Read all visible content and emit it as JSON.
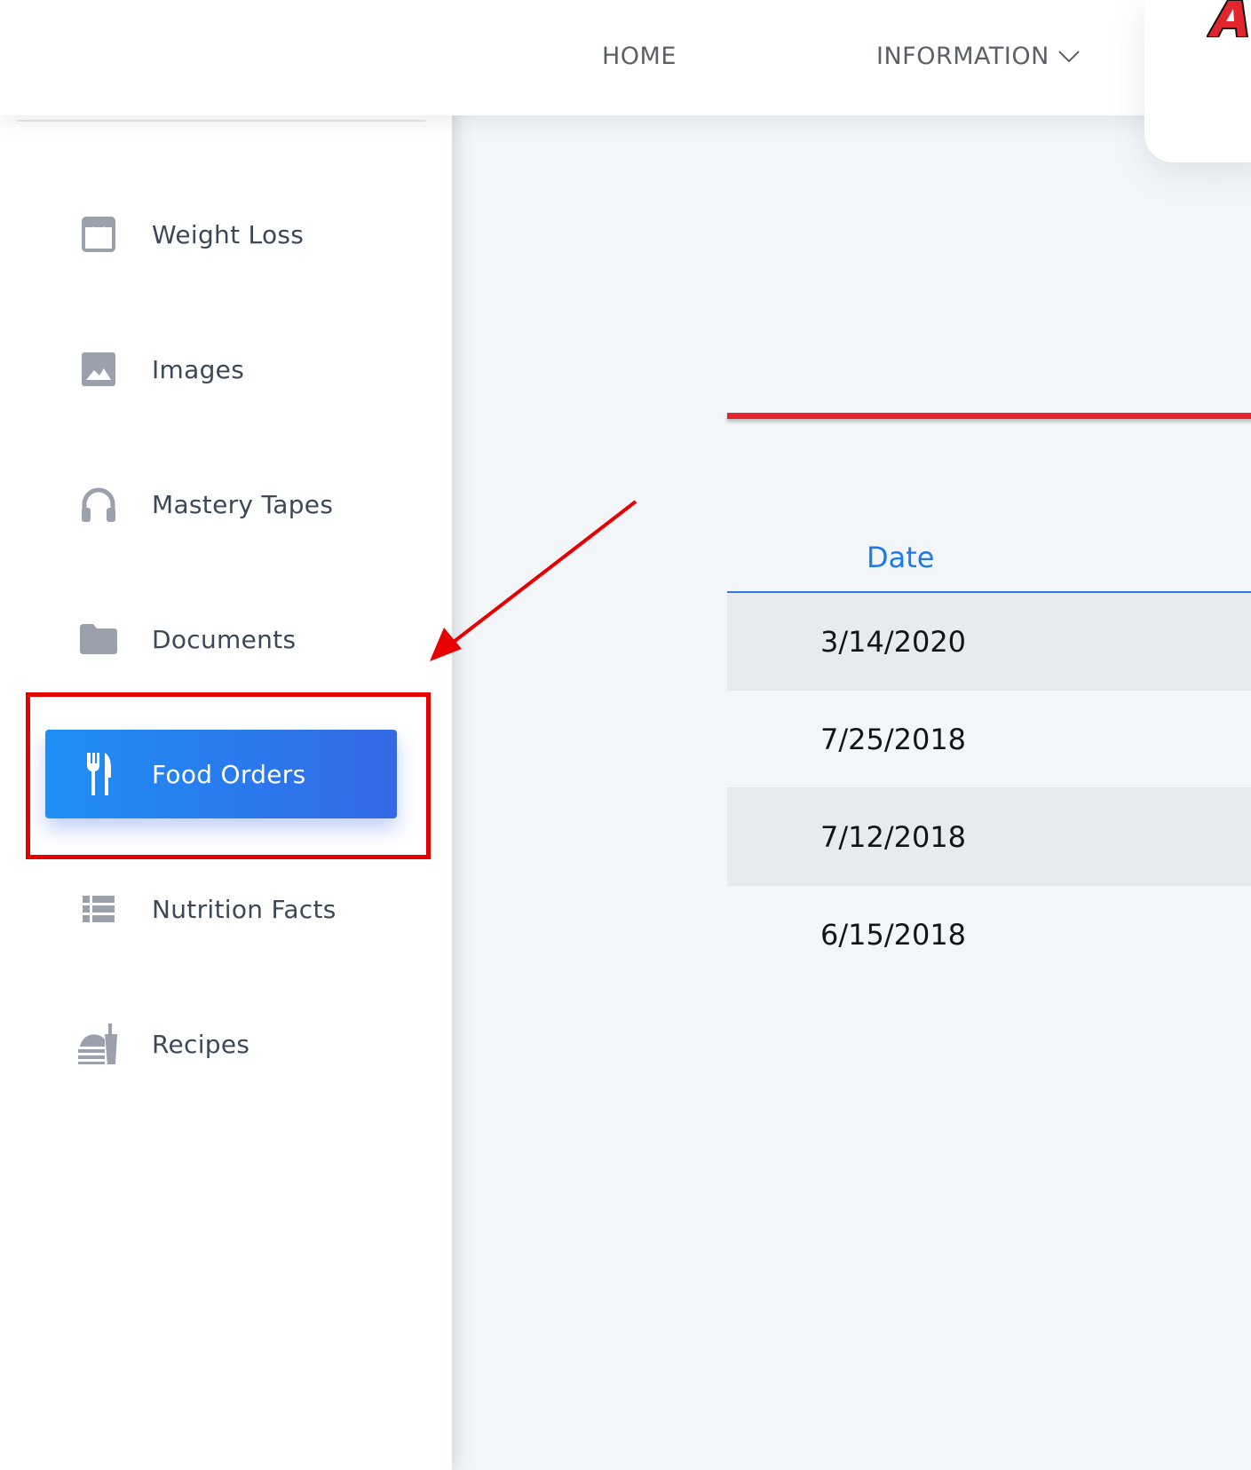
{
  "topnav": {
    "links": [
      {
        "label": "HOME"
      },
      {
        "label": "INFORMATION"
      }
    ]
  },
  "sidebar": {
    "items": [
      {
        "label": "Weight Loss",
        "icon": "shopping-bag-icon"
      },
      {
        "label": "Images",
        "icon": "image-icon"
      },
      {
        "label": "Mastery Tapes",
        "icon": "headphones-icon"
      },
      {
        "label": "Documents",
        "icon": "folder-icon"
      },
      {
        "label": "Food Orders",
        "icon": "utensils-icon",
        "active": true
      },
      {
        "label": "Nutrition Facts",
        "icon": "list-icon"
      },
      {
        "label": "Recipes",
        "icon": "food-tray-icon"
      }
    ]
  },
  "table": {
    "header": "Date",
    "rows": [
      "3/14/2020",
      "7/25/2018",
      "7/12/2018",
      "6/15/2018"
    ]
  },
  "colors": {
    "accent": "#2f78e3",
    "active_gradient_start": "#1e90f5",
    "active_gradient_end": "#3468e6",
    "annotation_red": "#e60000",
    "sidebar_icon": "#9aa1ad"
  }
}
